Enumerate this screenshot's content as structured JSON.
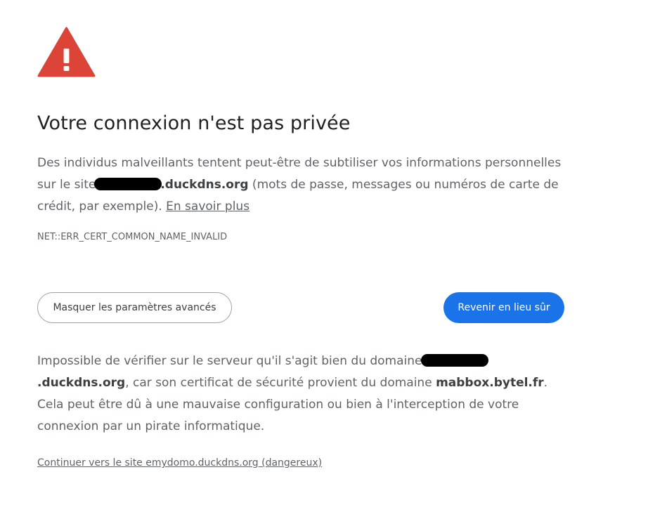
{
  "colors": {
    "warning_red": "#db4437",
    "primary_button": "#1a73e8",
    "text_secondary": "#5f6368"
  },
  "warning": {
    "icon": "warning-triangle-icon"
  },
  "title": "Votre connexion n'est pas privée",
  "intro": {
    "before_host": "Des individus malveillants tentent peut-être de subtiliser vos informations personnelles sur le site",
    "host_suffix": ".duckdns.org",
    "after_host": " (mots de passe, messages ou numéros de carte de crédit, par exemple). ",
    "learn_more": "En savoir plus"
  },
  "error_code": "NET::ERR_CERT_COMMON_NAME_INVALID",
  "buttons": {
    "advanced": "Masquer les paramètres avancés",
    "back_to_safety": "Revenir en lieu sûr"
  },
  "details": {
    "before_host": "Impossible de vérifier sur le serveur qu'il s'agit bien du domaine",
    "host_suffix": ".duckdns.org",
    "middle": ", car son certificat de sécurité provient du domaine ",
    "cert_domain": "mabbox.bytel.fr",
    "after": ". Cela peut être dû à une mauvaise configuration ou bien à l'interception de votre connexion par un pirate informatique."
  },
  "proceed_link": "Continuer vers le site emydomo.duckdns.org (dangereux)"
}
